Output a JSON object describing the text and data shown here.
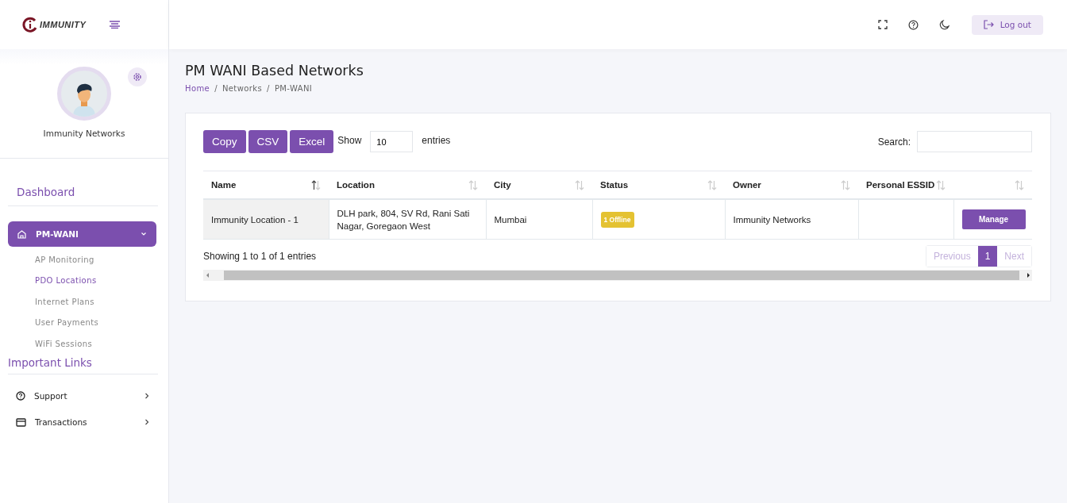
{
  "logo": {
    "text": "IMMUNITY"
  },
  "topbar": {
    "logout": "Log out"
  },
  "profile": {
    "name": "Immunity Networks"
  },
  "sidebar": {
    "dashboard": "Dashboard",
    "menu": {
      "label": "PM-WANI",
      "selected": true,
      "expanded": true,
      "children": [
        {
          "label": "AP Monitoring",
          "selected": false
        },
        {
          "label": "PDO Locations",
          "selected": true
        },
        {
          "label": "Internet Plans",
          "selected": false
        },
        {
          "label": "User Payments",
          "selected": false
        },
        {
          "label": "WiFi Sessions",
          "selected": false
        }
      ]
    },
    "links_title": "Important Links",
    "links": [
      {
        "label": "Support",
        "kind": "help"
      },
      {
        "label": "Transactions",
        "kind": "card"
      }
    ]
  },
  "page": {
    "title": "PM WANI Based Networks",
    "breadcrumb": [
      "Home",
      "Networks",
      "PM-WANI"
    ],
    "breadcrumb_separator": "/"
  },
  "table_tools": {
    "buttons": [
      "Copy",
      "CSV",
      "Excel"
    ],
    "show_label": "Show",
    "page_size": "10",
    "entries_label": "entries",
    "search_label": "Search:"
  },
  "table": {
    "columns": [
      {
        "label": "Name",
        "sorted": true
      },
      {
        "label": "Location",
        "sorted": false
      },
      {
        "label": "City",
        "sorted": false
      },
      {
        "label": "Status",
        "sorted": false
      },
      {
        "label": "Owner",
        "sorted": false
      },
      {
        "label": "Personal ESSID",
        "sorted": false
      },
      {
        "sorted": false
      }
    ],
    "rows": [
      {
        "name": "Immunity Location - 1",
        "location": "DLH park, 804, SV Rd, Rani Sati Nagar, Goregaon West",
        "city": "Mumbai",
        "status": "1 Offline",
        "color": "#e4c232",
        "owner": "Immunity Networks",
        "action": "Manage"
      }
    ]
  },
  "footer": {
    "info": "Showing 1 to 1 of 1 entries",
    "pagination": [
      {
        "label": "Previous",
        "kind": "nav",
        "disabled": true
      },
      {
        "label": "1",
        "kind": "page",
        "selected": true
      },
      {
        "label": "Next",
        "kind": "nav",
        "disabled": true
      }
    ]
  }
}
